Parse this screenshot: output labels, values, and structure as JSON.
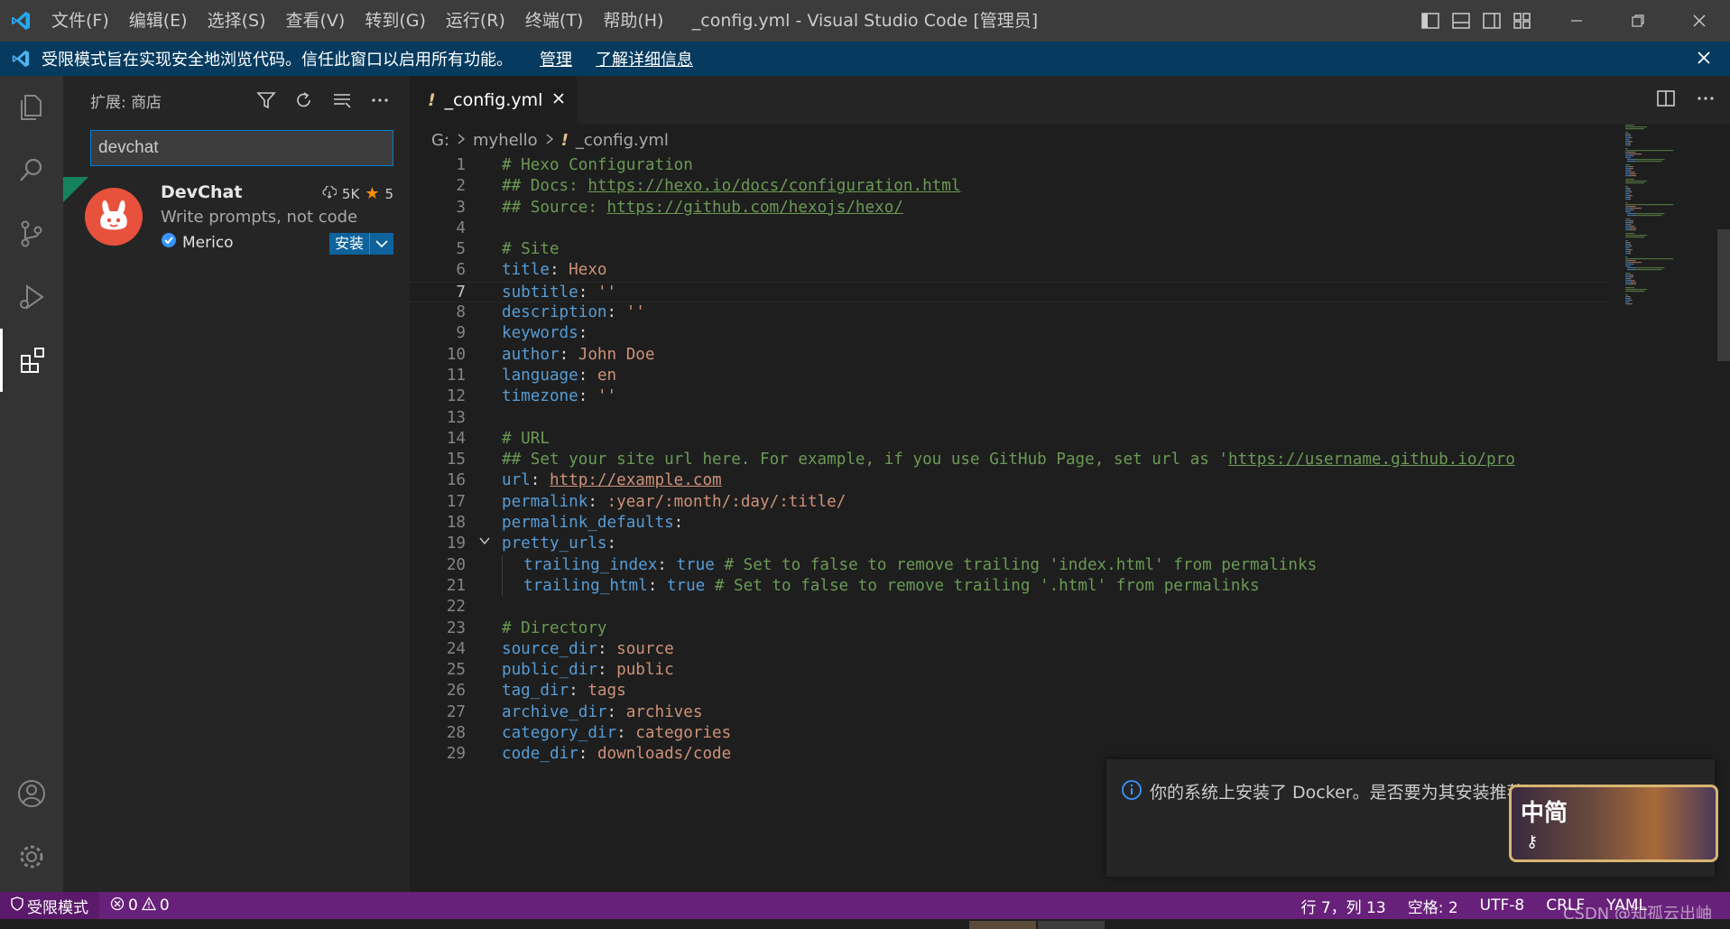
{
  "titlebar": {
    "menus": [
      "文件(F)",
      "编辑(E)",
      "选择(S)",
      "查看(V)",
      "转到(G)",
      "运行(R)",
      "终端(T)",
      "帮助(H)"
    ],
    "title": "_config.yml - Visual Studio Code [管理员]"
  },
  "banner": {
    "text": "受限模式旨在实现安全地浏览代码。信任此窗口以启用所有功能。",
    "manage": "管理",
    "learn_more": "了解详细信息"
  },
  "sidebar": {
    "title": "扩展: 商店",
    "search_value": "devchat",
    "extension": {
      "name": "DevChat",
      "downloads": "5K",
      "rating": "5",
      "description": "Write prompts, not code",
      "publisher": "Merico",
      "install_label": "安装"
    }
  },
  "editor": {
    "tab_label": "_config.yml",
    "breadcrumb": [
      "G:",
      "myhello",
      "_config.yml"
    ],
    "cursor_line": 7,
    "lines": [
      {
        "n": "1",
        "parts": [
          [
            "c",
            "# Hexo Configuration"
          ]
        ]
      },
      {
        "n": "2",
        "parts": [
          [
            "c",
            "## Docs: "
          ],
          [
            "uc",
            "https://hexo.io/docs/configuration.html"
          ]
        ]
      },
      {
        "n": "3",
        "parts": [
          [
            "c",
            "## Source: "
          ],
          [
            "uc",
            "https://github.com/hexojs/hexo/"
          ]
        ]
      },
      {
        "n": "4",
        "parts": []
      },
      {
        "n": "5",
        "parts": [
          [
            "c",
            "# Site"
          ]
        ]
      },
      {
        "n": "6",
        "parts": [
          [
            "k",
            "title"
          ],
          [
            "p",
            ": "
          ],
          [
            "s",
            "Hexo"
          ]
        ]
      },
      {
        "n": "7",
        "parts": [
          [
            "k",
            "subtitle"
          ],
          [
            "p",
            ": "
          ],
          [
            "s",
            "''"
          ]
        ]
      },
      {
        "n": "8",
        "parts": [
          [
            "k",
            "description"
          ],
          [
            "p",
            ": "
          ],
          [
            "s",
            "''"
          ]
        ]
      },
      {
        "n": "9",
        "parts": [
          [
            "k",
            "keywords"
          ],
          [
            "p",
            ":"
          ]
        ]
      },
      {
        "n": "10",
        "parts": [
          [
            "k",
            "author"
          ],
          [
            "p",
            ": "
          ],
          [
            "s",
            "John Doe"
          ]
        ]
      },
      {
        "n": "11",
        "parts": [
          [
            "k",
            "language"
          ],
          [
            "p",
            ": "
          ],
          [
            "s",
            "en"
          ]
        ]
      },
      {
        "n": "12",
        "parts": [
          [
            "k",
            "timezone"
          ],
          [
            "p",
            ": "
          ],
          [
            "s",
            "''"
          ]
        ]
      },
      {
        "n": "13",
        "parts": []
      },
      {
        "n": "14",
        "parts": [
          [
            "c",
            "# URL"
          ]
        ]
      },
      {
        "n": "15",
        "parts": [
          [
            "c",
            "## Set your site url here. For example, if you use GitHub Page, set url as '"
          ],
          [
            "uc",
            "https://username.github.io/pro"
          ]
        ]
      },
      {
        "n": "16",
        "parts": [
          [
            "k",
            "url"
          ],
          [
            "p",
            ": "
          ],
          [
            "u",
            "http://example.com"
          ]
        ]
      },
      {
        "n": "17",
        "parts": [
          [
            "k",
            "permalink"
          ],
          [
            "p",
            ": "
          ],
          [
            "s",
            ":year/:month/:day/:title/"
          ]
        ]
      },
      {
        "n": "18",
        "parts": [
          [
            "k",
            "permalink_defaults"
          ],
          [
            "p",
            ":"
          ]
        ]
      },
      {
        "n": "19",
        "fold": true,
        "parts": [
          [
            "k",
            "pretty_urls"
          ],
          [
            "p",
            ":"
          ]
        ]
      },
      {
        "n": "20",
        "indent": true,
        "parts": [
          [
            "k",
            "trailing_index"
          ],
          [
            "p",
            ": "
          ],
          [
            "b",
            "true"
          ],
          [
            "c",
            " # Set to false to remove trailing 'index.html' from permalinks"
          ]
        ]
      },
      {
        "n": "21",
        "indent": true,
        "parts": [
          [
            "k",
            "trailing_html"
          ],
          [
            "p",
            ": "
          ],
          [
            "b",
            "true"
          ],
          [
            "c",
            " # Set to false to remove trailing '.html' from permalinks"
          ]
        ]
      },
      {
        "n": "22",
        "parts": []
      },
      {
        "n": "23",
        "parts": [
          [
            "c",
            "# Directory"
          ]
        ]
      },
      {
        "n": "24",
        "parts": [
          [
            "k",
            "source_dir"
          ],
          [
            "p",
            ": "
          ],
          [
            "s",
            "source"
          ]
        ]
      },
      {
        "n": "25",
        "parts": [
          [
            "k",
            "public_dir"
          ],
          [
            "p",
            ": "
          ],
          [
            "s",
            "public"
          ]
        ]
      },
      {
        "n": "26",
        "parts": [
          [
            "k",
            "tag_dir"
          ],
          [
            "p",
            ": "
          ],
          [
            "s",
            "tags"
          ]
        ]
      },
      {
        "n": "27",
        "parts": [
          [
            "k",
            "archive_dir"
          ],
          [
            "p",
            ": "
          ],
          [
            "s",
            "archives"
          ]
        ]
      },
      {
        "n": "28",
        "parts": [
          [
            "k",
            "category_dir"
          ],
          [
            "p",
            ": "
          ],
          [
            "s",
            "categories"
          ]
        ]
      },
      {
        "n": "29",
        "parts": [
          [
            "k",
            "code_dir"
          ],
          [
            "p",
            ": "
          ],
          [
            "s",
            "downloads/code"
          ]
        ]
      }
    ]
  },
  "notification": {
    "text": "你的系统上安装了 Docker。是否要为其安装推荐",
    "ime_label": "中简"
  },
  "statusbar": {
    "restricted": "受限模式",
    "errors": "0",
    "warnings": "0",
    "position": "行 7，列 13",
    "spaces": "空格: 2",
    "encoding": "UTF-8",
    "eol": "CRLF",
    "language": "YAML"
  },
  "watermark": "CSDN @知孤云出岫",
  "colors": {
    "accent": "#007acc",
    "statusbar": "#68217a",
    "banner": "#063b5f"
  }
}
